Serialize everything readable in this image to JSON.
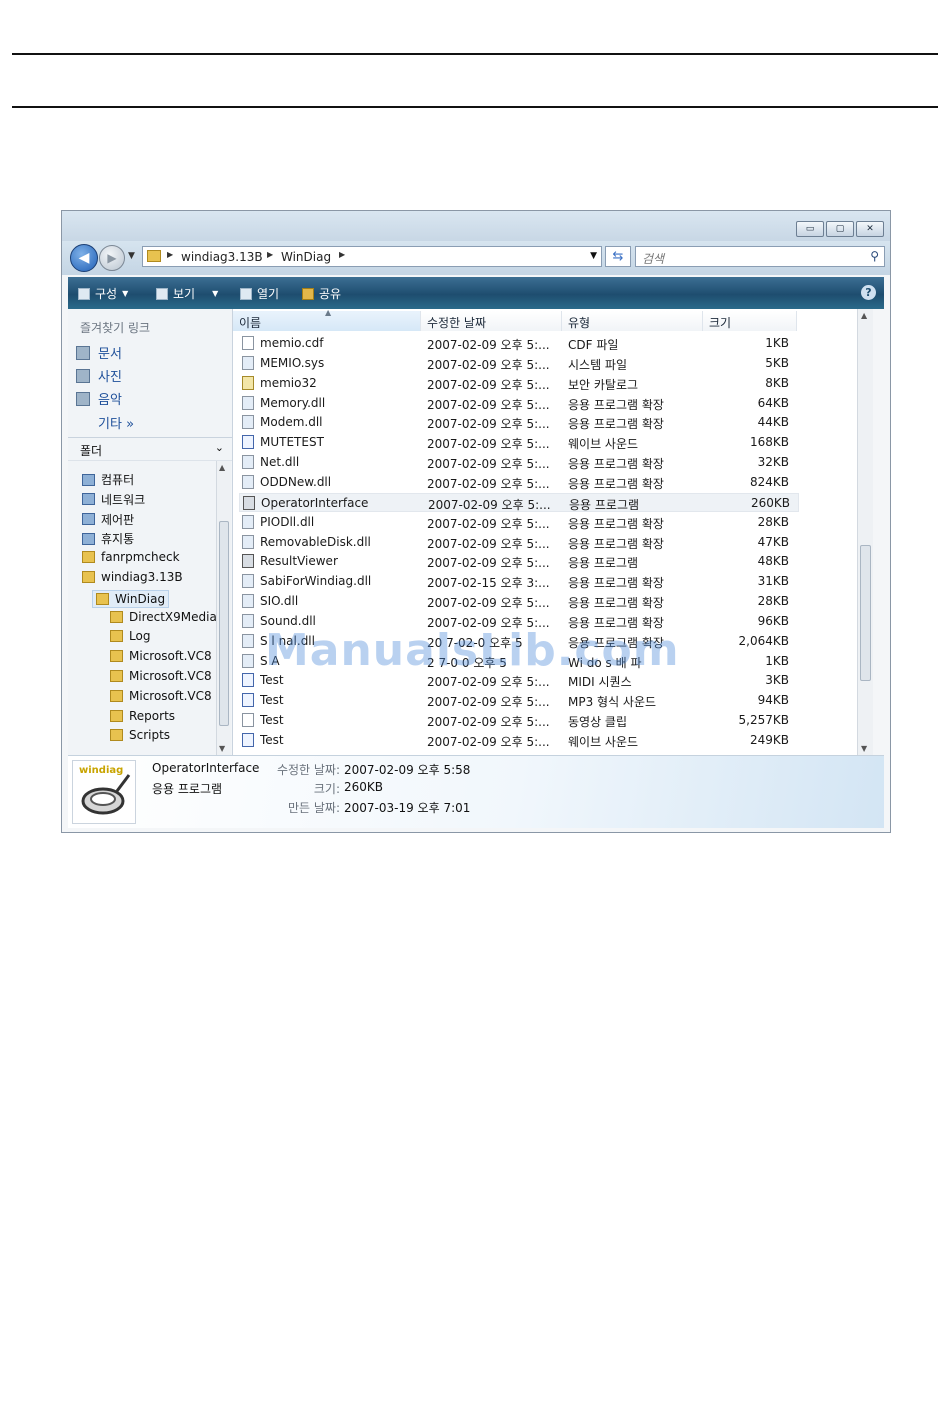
{
  "address": {
    "crumbs": [
      "windiag3.13B",
      "WinDiag"
    ]
  },
  "search": {
    "placeholder": "검색"
  },
  "window_controls": {
    "minimize": "▭",
    "maximize": "▢",
    "close": "✕"
  },
  "toolbar": {
    "organize": "구성",
    "views": "보기",
    "open": "열기",
    "share": "공유"
  },
  "favorites": {
    "header": "즐겨찾기 링크",
    "items": [
      "문서",
      "사진",
      "음악"
    ],
    "more": "기타"
  },
  "folders": {
    "header": "폴더",
    "items": [
      {
        "label": "컴퓨터",
        "icon": "computer-icon"
      },
      {
        "label": "네트워크",
        "icon": "network-icon"
      },
      {
        "label": "제어판",
        "icon": "control-panel-icon"
      },
      {
        "label": "휴지통",
        "icon": "recycle-bin-icon"
      },
      {
        "label": "fanrpmcheck",
        "icon": "folder-icon"
      },
      {
        "label": "windiag3.13B",
        "icon": "folder-icon"
      },
      {
        "label": "WinDiag",
        "icon": "folder-icon",
        "selected": true
      },
      {
        "label": "DirectX9Media",
        "icon": "folder-icon"
      },
      {
        "label": "Log",
        "icon": "folder-icon"
      },
      {
        "label": "Microsoft.VC8",
        "icon": "folder-icon"
      },
      {
        "label": "Microsoft.VC8",
        "icon": "folder-icon"
      },
      {
        "label": "Microsoft.VC8",
        "icon": "folder-icon"
      },
      {
        "label": "Reports",
        "icon": "folder-icon"
      },
      {
        "label": "Scripts",
        "icon": "folder-icon"
      }
    ]
  },
  "columns": {
    "name": "이름",
    "date": "수정한 날짜",
    "type": "유형",
    "size": "크기"
  },
  "files": [
    {
      "name": "memio.cdf",
      "date": "2007-02-09 오후 5:...",
      "type": "CDF 파일",
      "size": "1KB",
      "kind": "file"
    },
    {
      "name": "MEMIO.sys",
      "date": "2007-02-09 오후 5:...",
      "type": "시스템 파일",
      "size": "5KB",
      "kind": "dll"
    },
    {
      "name": "memio32",
      "date": "2007-02-09 오후 5:...",
      "type": "보안 카탈로그",
      "size": "8KB",
      "kind": "cat"
    },
    {
      "name": "Memory.dll",
      "date": "2007-02-09 오후 5:...",
      "type": "응용 프로그램 확장",
      "size": "64KB",
      "kind": "dll"
    },
    {
      "name": "Modem.dll",
      "date": "2007-02-09 오후 5:...",
      "type": "응용 프로그램 확장",
      "size": "44KB",
      "kind": "dll"
    },
    {
      "name": "MUTETEST",
      "date": "2007-02-09 오후 5:...",
      "type": "웨이브 사운드",
      "size": "168KB",
      "kind": "snd"
    },
    {
      "name": "Net.dll",
      "date": "2007-02-09 오후 5:...",
      "type": "응용 프로그램 확장",
      "size": "32KB",
      "kind": "dll"
    },
    {
      "name": "ODDNew.dll",
      "date": "2007-02-09 오후 5:...",
      "type": "응용 프로그램 확장",
      "size": "824KB",
      "kind": "dll"
    },
    {
      "name": "OperatorInterface",
      "date": "2007-02-09 오후 5:...",
      "type": "응용 프로그램",
      "size": "260KB",
      "kind": "exe",
      "selected": true
    },
    {
      "name": "PIODll.dll",
      "date": "2007-02-09 오후 5:...",
      "type": "응용 프로그램 확장",
      "size": "28KB",
      "kind": "dll"
    },
    {
      "name": "RemovableDisk.dll",
      "date": "2007-02-09 오후 5:...",
      "type": "응용 프로그램 확장",
      "size": "47KB",
      "kind": "dll"
    },
    {
      "name": "ResultViewer",
      "date": "2007-02-09 오후 5:...",
      "type": "응용 프로그램",
      "size": "48KB",
      "kind": "exe"
    },
    {
      "name": "SabiForWindiag.dll",
      "date": "2007-02-15 오후 3:...",
      "type": "응용 프로그램 확장",
      "size": "31KB",
      "kind": "dll"
    },
    {
      "name": "SIO.dll",
      "date": "2007-02-09 오후 5:...",
      "type": "응용 프로그램 확장",
      "size": "28KB",
      "kind": "dll"
    },
    {
      "name": "Sound.dll",
      "date": "2007-02-09 오후 5:...",
      "type": "응용 프로그램 확장",
      "size": "96KB",
      "kind": "dll"
    },
    {
      "name": "S   l   nal.dll",
      "date": "20  7-02-0   오후 5",
      "type": "응용 프로그램 확장",
      "size": "2,064KB",
      "kind": "dll"
    },
    {
      "name": "S  A",
      "date": "2  7-0  0   오후 5",
      "type": "Wi  do  s 배   파",
      "size": "1KB",
      "kind": "dll"
    },
    {
      "name": "Test",
      "date": "2007-02-09 오후 5:...",
      "type": "MIDI 시퀀스",
      "size": "3KB",
      "kind": "snd"
    },
    {
      "name": "Test",
      "date": "2007-02-09 오후 5:...",
      "type": "MP3 형식 사운드",
      "size": "94KB",
      "kind": "snd"
    },
    {
      "name": "Test",
      "date": "2007-02-09 오후 5:...",
      "type": "동영상 클립",
      "size": "5,257KB",
      "kind": "file"
    },
    {
      "name": "Test",
      "date": "2007-02-09 오후 5:...",
      "type": "웨이브 사운드",
      "size": "249KB",
      "kind": "snd"
    }
  ],
  "details": {
    "thumb_label": "windiag",
    "name": "OperatorInterface",
    "type": "응용 프로그램",
    "modified_label": "수정한 날짜:",
    "modified_value": "2007-02-09 오후 5:58",
    "size_label": "크기:",
    "size_value": "260KB",
    "created_label": "만든 날짜:",
    "created_value": "2007-03-19 오후 7:01"
  },
  "watermark": "ManualsLib.com"
}
